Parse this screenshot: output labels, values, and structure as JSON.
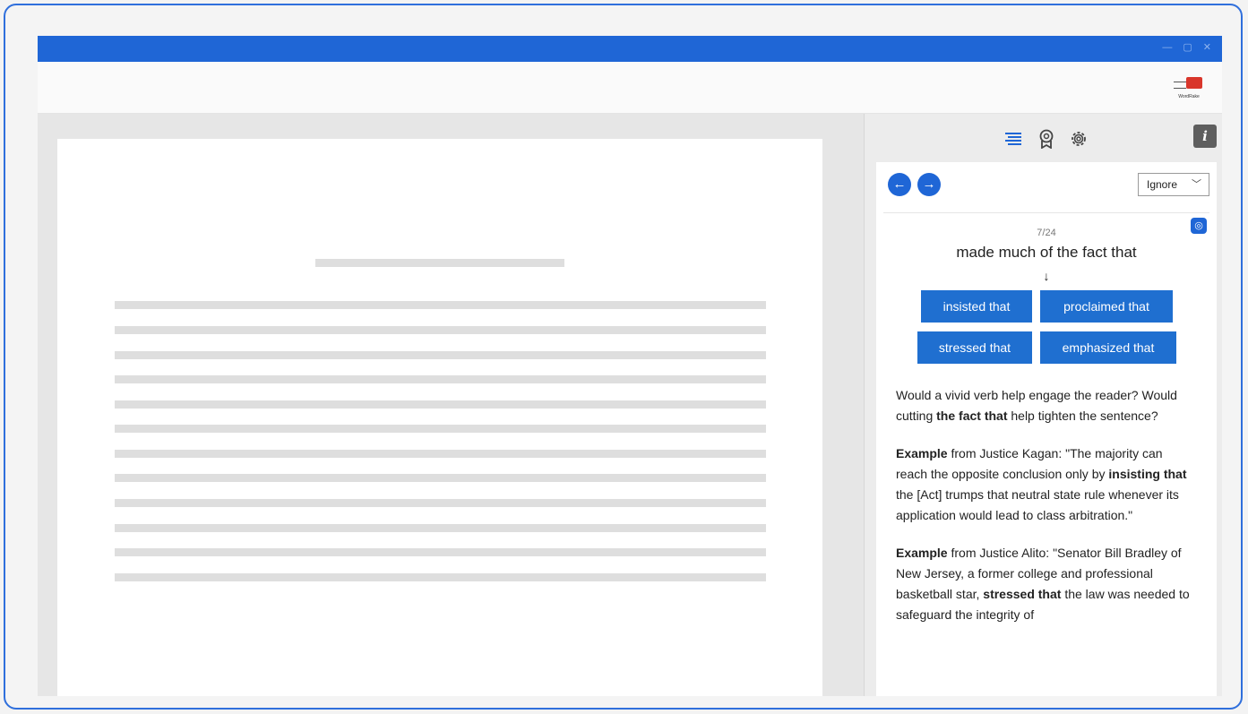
{
  "window": {
    "controls": [
      "—",
      "▢",
      "✕"
    ]
  },
  "logo": {
    "icon": "wordrake-logo",
    "text": "WordRake"
  },
  "panel": {
    "tool_icons": [
      "suggestions-list-icon",
      "award-ribbon-icon",
      "gear-icon"
    ],
    "info_label": "i",
    "nav": {
      "prev_icon": "←",
      "next_icon": "→",
      "ignore_label": "Ignore",
      "ignore_chevron": "﹀"
    },
    "counter": "7/24",
    "phrase": "made much of the fact that",
    "arrow": "↓",
    "suggestions": [
      "insisted that",
      "proclaimed that",
      "stressed that",
      "emphasized that"
    ],
    "explanation": {
      "p1_a": "Would a vivid verb help engage the reader? Would cutting ",
      "p1_bold": "the fact that",
      "p1_b": " help tighten the sentence?",
      "p2_bold1": "Example",
      "p2_a": " from Justice Kagan: \"The majority can reach the opposite conclusion only by ",
      "p2_bold2": "insisting that",
      "p2_b": " the [Act] trumps that neutral state rule whenever its application would lead to class arbitration.\"",
      "p3_bold1": "Example",
      "p3_a": " from Justice Alito: \"Senator Bill Bradley of New Jersey, a former college and professional basketball star, ",
      "p3_bold2": "stressed that",
      "p3_b": " the law was needed to safeguard the integrity of"
    }
  },
  "colors": {
    "accent": "#1f66d6",
    "frame_border": "#2f6fdc"
  }
}
